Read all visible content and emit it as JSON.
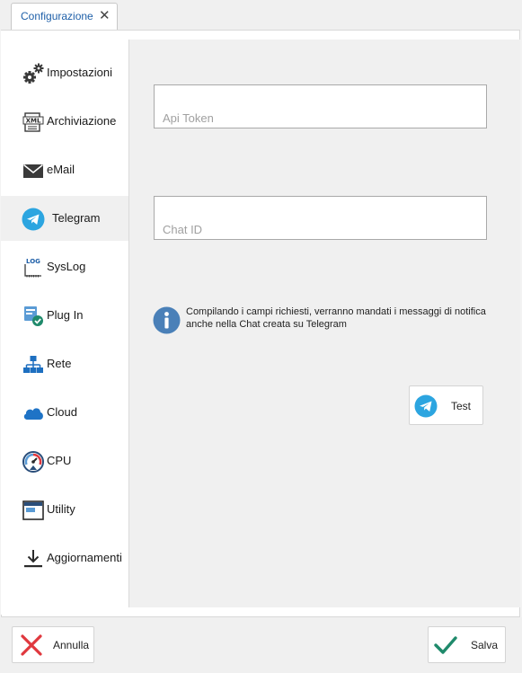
{
  "tab": {
    "title": "Configurazione",
    "close_glyph": "✕"
  },
  "sidebar": {
    "items": [
      {
        "label": "Impostazioni",
        "icon": "gears-icon"
      },
      {
        "label": "Archiviazione",
        "icon": "xml-file-icon"
      },
      {
        "label": "eMail",
        "icon": "envelope-icon"
      },
      {
        "label": "Telegram",
        "icon": "telegram-icon",
        "active": true
      },
      {
        "label": "SysLog",
        "icon": "log-icon"
      },
      {
        "label": "Plug In",
        "icon": "plugin-icon"
      },
      {
        "label": "Rete",
        "icon": "network-icon"
      },
      {
        "label": "Cloud",
        "icon": "cloud-icon"
      },
      {
        "label": "CPU",
        "icon": "gauge-icon"
      },
      {
        "label": "Utility",
        "icon": "window-icon"
      },
      {
        "label": "Aggiornamenti",
        "icon": "download-icon"
      }
    ]
  },
  "telegram": {
    "api_token_placeholder": "Api Token",
    "api_token_value": "",
    "chat_id_placeholder": "Chat ID",
    "chat_id_value": "",
    "info_text": "Compilando i campi richiesti, verranno mandati i messaggi di notifica anche nella Chat creata su Telegram",
    "test_label": "Test"
  },
  "footer": {
    "cancel_label": "Annulla",
    "save_label": "Salva"
  },
  "colors": {
    "accent": "#1e5fa8",
    "telegram": "#2ca5e0",
    "cancel": "#e0383e",
    "save": "#1f8a6b",
    "info": "#4a80b8"
  }
}
